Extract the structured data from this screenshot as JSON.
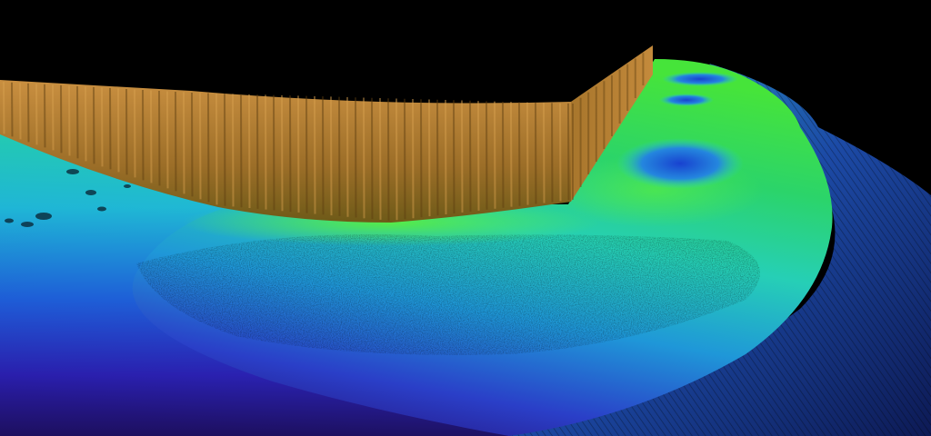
{
  "scene": {
    "description_visible_text": "",
    "colors": {
      "background": "#000000",
      "wall_top": "#c9913e",
      "wall_bottom": "#7a5a1e",
      "seabed_green": "#2fd64a",
      "seabed_cyan": "#27d6c8",
      "seabed_blue": "#1d6fe0",
      "seabed_violet": "#3a1ca8",
      "depression_blue": "#1a4fd6"
    },
    "color_scale_order": [
      "orange",
      "green",
      "cyan",
      "blue",
      "violet"
    ]
  }
}
